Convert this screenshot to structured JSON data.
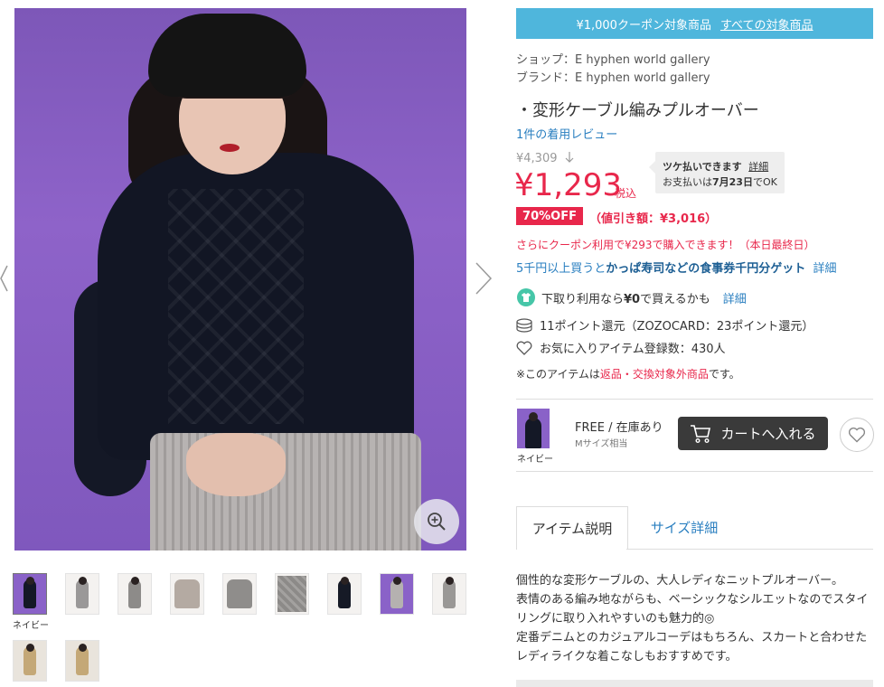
{
  "coupon_banner": {
    "text": "¥1,000クーポン対象商品",
    "link": "すべての対象商品"
  },
  "shop": {
    "label": "ショップ：",
    "name": "E hyphen world gallery"
  },
  "brand": {
    "label": "ブランド：",
    "name": "E hyphen world gallery"
  },
  "product_title": "・変形ケーブル編みプルオーバー",
  "review_link": "1件の着用レビュー",
  "original_price": "¥4,309",
  "price": "¥1,293",
  "tax_label": "税込",
  "tsuke": {
    "title": "ツケ払いできます",
    "detail": "詳細",
    "line_prefix": "お支払いは",
    "date": "7月23日",
    "line_suffix": "でOK"
  },
  "discount": {
    "badge": "70%OFF",
    "amount": "（値引き額：¥3,016）"
  },
  "coupon_note": "さらにクーポン利用で¥293で購入できます！（本日最終日）",
  "promo": {
    "prefix": "5千円以上買うと",
    "bold": "かっぱ寿司などの食事券千円分ゲット",
    "link": "詳細"
  },
  "trade_in": {
    "prefix": "下取り利用なら",
    "bold": "¥0",
    "suffix": "で買えるかも",
    "link": "詳細"
  },
  "points": "11ポイント還元（ZOZOCARD：23ポイント還元）",
  "favorites": "お気に入りアイテム登録数：430人",
  "return_note": {
    "prefix": "※このアイテムは",
    "red": "返品・交換対象外商品",
    "suffix": "です。"
  },
  "variant": {
    "color_name": "ネイビー",
    "size": "FREE / 在庫あり",
    "size_note": "Mサイズ相当",
    "cart_button": "カートへ入れる"
  },
  "tabs": [
    "アイテム説明",
    "サイズ詳細"
  ],
  "description": [
    "個性的な変形ケーブルの、大人レディなニットプルオーバー。",
    "表情のある編み地ながらも、ベーシックなシルエットなのでスタイ",
    "リングに取り入れやすいのも魅力的◎",
    "定番デニムとのカジュアルコーデはもちろん、スカートと合わせた",
    "レディライクな着こなしもおすすめです。"
  ],
  "thumbnail_caption": "ネイビー",
  "icons": {
    "zoom": "magnifier-plus-icon",
    "prev": "chevron-left-icon",
    "next": "chevron-right-icon",
    "trade_in": "tshirt-icon",
    "points": "coin-stack-icon",
    "favorite": "heart-icon",
    "cart": "cart-icon",
    "down_arrow": "arrow-down-icon"
  },
  "colors": {
    "accent_red": "#e8274b",
    "link_blue": "#2a7fc0",
    "banner_blue": "#4fb6dc",
    "cart_dark": "#3a3a3a"
  }
}
